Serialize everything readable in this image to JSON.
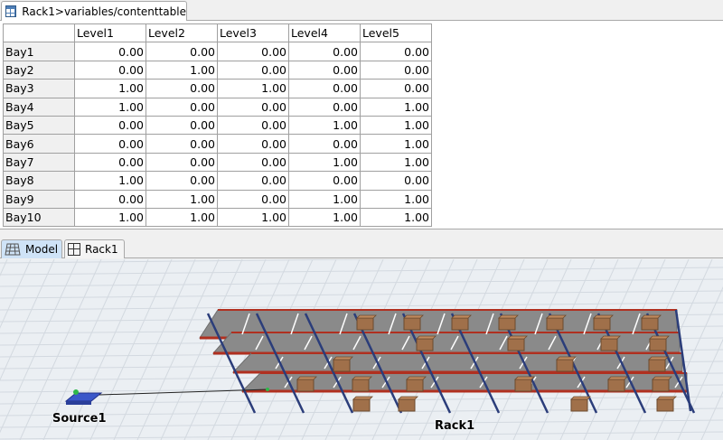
{
  "document_tab": {
    "title": "Rack1>variables/contenttable",
    "icon": "table-icon"
  },
  "table": {
    "columns": [
      "Level1",
      "Level2",
      "Level3",
      "Level4",
      "Level5"
    ],
    "rows": [
      {
        "label": "Bay1",
        "values": [
          "0.00",
          "0.00",
          "0.00",
          "0.00",
          "0.00"
        ]
      },
      {
        "label": "Bay2",
        "values": [
          "0.00",
          "1.00",
          "0.00",
          "0.00",
          "0.00"
        ]
      },
      {
        "label": "Bay3",
        "values": [
          "1.00",
          "0.00",
          "1.00",
          "0.00",
          "0.00"
        ]
      },
      {
        "label": "Bay4",
        "values": [
          "1.00",
          "0.00",
          "0.00",
          "0.00",
          "1.00"
        ]
      },
      {
        "label": "Bay5",
        "values": [
          "0.00",
          "0.00",
          "0.00",
          "1.00",
          "1.00"
        ]
      },
      {
        "label": "Bay6",
        "values": [
          "0.00",
          "0.00",
          "0.00",
          "0.00",
          "1.00"
        ]
      },
      {
        "label": "Bay7",
        "values": [
          "0.00",
          "0.00",
          "0.00",
          "1.00",
          "1.00"
        ]
      },
      {
        "label": "Bay8",
        "values": [
          "1.00",
          "0.00",
          "0.00",
          "0.00",
          "0.00"
        ]
      },
      {
        "label": "Bay9",
        "values": [
          "0.00",
          "1.00",
          "0.00",
          "1.00",
          "1.00"
        ]
      },
      {
        "label": "Bay10",
        "values": [
          "1.00",
          "1.00",
          "1.00",
          "1.00",
          "1.00"
        ]
      }
    ]
  },
  "view_tabs": [
    {
      "label": "Model",
      "icon": "model-grid-icon",
      "active": true
    },
    {
      "label": "Rack1",
      "icon": "rack-icon",
      "active": false
    }
  ],
  "model_view": {
    "source_label": "Source1",
    "rack_label": "Rack1",
    "colors": {
      "floor": "#ebeff3",
      "grid_line": "#d3d9e0",
      "beam": "#b03020",
      "shelf": "#8a8a8a",
      "post": "#2b3d7a",
      "box": "#a0704a"
    }
  }
}
